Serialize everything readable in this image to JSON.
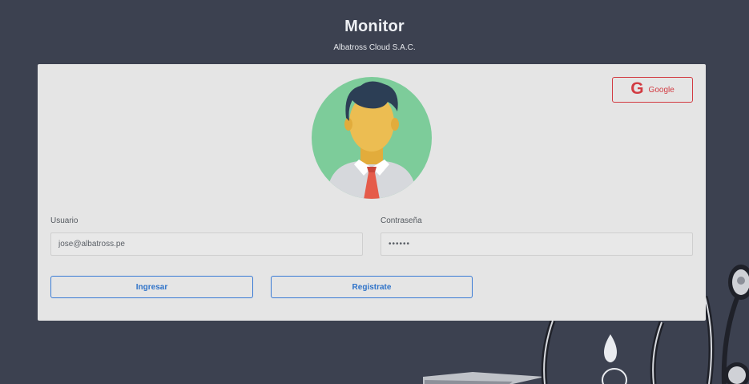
{
  "header": {
    "title": "Monitor",
    "subtitle": "Albatross Cloud S.A.C."
  },
  "login": {
    "google_label": "Google",
    "google_icon": "google-g-icon",
    "usuario_label": "Usuario",
    "usuario_value": "jose@albatross.pe",
    "password_label": "Contraseña",
    "password_value": "••••••",
    "ingresar_label": "Ingresar",
    "registrate_label": "Registrate"
  },
  "colors": {
    "background": "#3c4150",
    "card": "#e5e5e5",
    "primary": "#3a7bd5",
    "google": "#d23b42",
    "avatar_bg": "#7dcc9a"
  }
}
